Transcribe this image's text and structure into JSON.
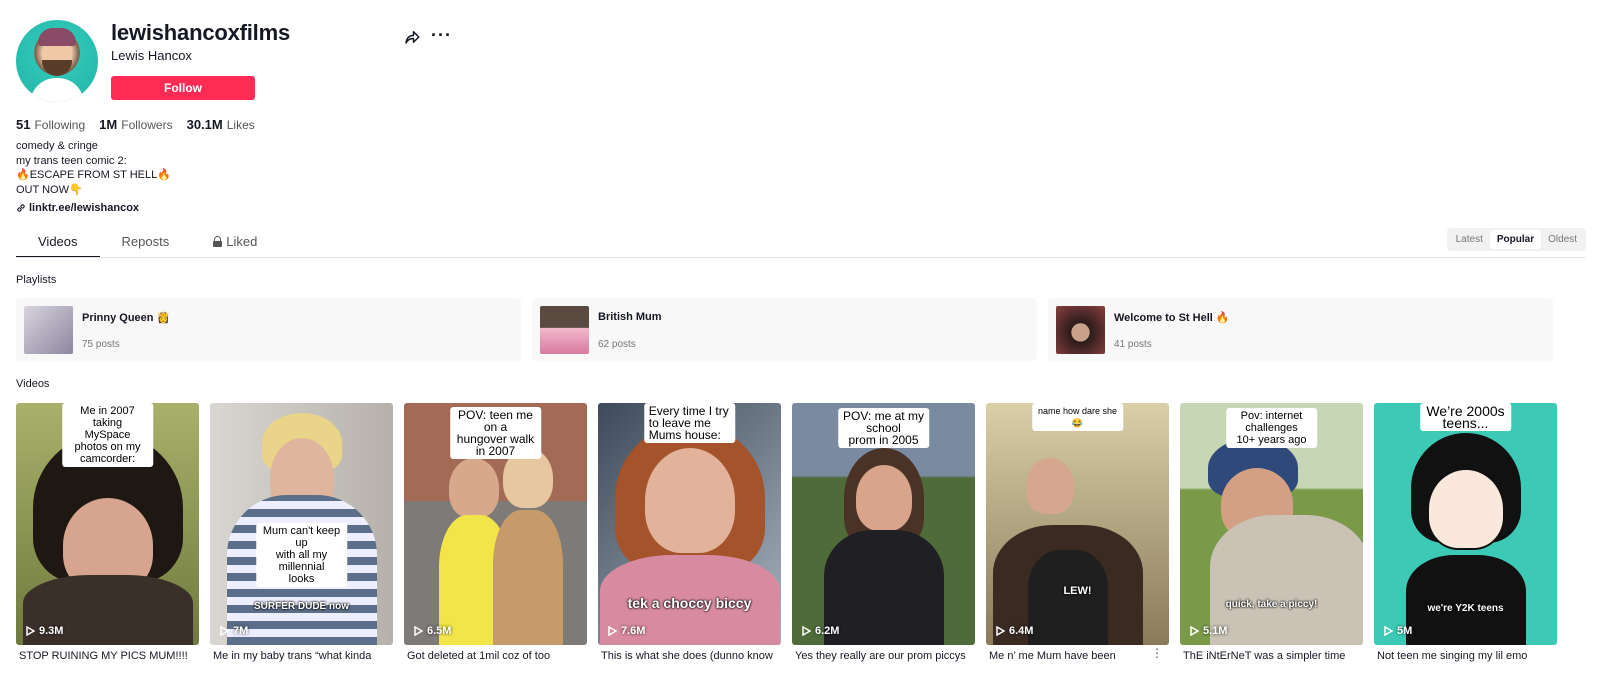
{
  "profile": {
    "username": "lewishancoxfilms",
    "display_name": "Lewis Hancox",
    "follow_label": "Follow",
    "stats": [
      {
        "value": "51",
        "label": "Following"
      },
      {
        "value": "1M",
        "label": "Followers"
      },
      {
        "value": "30.1M",
        "label": "Likes"
      }
    ],
    "bio": [
      "comedy & cringe",
      "my trans teen comic 2:",
      "🔥ESCAPE FROM ST HELL🔥",
      "OUT NOW👇"
    ],
    "link": "linktr.ee/lewishancox"
  },
  "tabs": [
    {
      "label": "Videos",
      "active": true
    },
    {
      "label": "Reposts",
      "active": false
    },
    {
      "label": "Liked",
      "active": false
    }
  ],
  "sort": [
    {
      "label": "Latest",
      "active": false
    },
    {
      "label": "Popular",
      "active": true
    },
    {
      "label": "Oldest",
      "active": false
    }
  ],
  "sections": {
    "playlists": "Playlists",
    "videos": "Videos"
  },
  "playlists": [
    {
      "name": "Prinny Queen 👸",
      "count": "75 posts",
      "color": "#b9b3c6"
    },
    {
      "name": "British Mum",
      "count": "62 posts",
      "color": "#e7a0b8"
    },
    {
      "name": "Welcome to St Hell 🔥",
      "count": "41 posts",
      "color": "#6b3b3b"
    }
  ],
  "videos": [
    {
      "title": "STOP RUINING MY PICS MUM!!!!",
      "views": "9.3M",
      "caption": "Me in 2007 taking\nMySpace photos on my\ncamcorder:",
      "overlay": "",
      "bg": "#8f9a52"
    },
    {
      "title": "Me in my baby trans “what kinda",
      "views": "7M",
      "caption": "Mum can't keep up\nwith all my millennial\nlooks",
      "overlay": "SURFER DUDE now",
      "bg": "#c9c5c0"
    },
    {
      "title": "Got deleted at 1mil coz of too",
      "views": "6.5M",
      "caption": "POV: teen me on a\nhungover walk in 2007",
      "overlay": "",
      "bg": "#8b5a4a"
    },
    {
      "title": "This is what she does (dunno know",
      "views": "7.6M",
      "caption": "Every time I try to leave me\nMums house:",
      "overlay": "tek a choccy biccy",
      "bg": "#6a7f95"
    },
    {
      "title": "Yes they really are our prom piccys",
      "views": "6.2M",
      "caption": "POV: me at my school\nprom in 2005",
      "overlay": "",
      "bg": "#5f6d52"
    },
    {
      "title": "Me n’ me Mum have been",
      "views": "6.4M",
      "caption": "name how dare she 😂",
      "overlay": "LEW!",
      "bg": "#b7a98a"
    },
    {
      "title": "ThE iNtErNeT was a simpler time",
      "views": "5.1M",
      "caption": "Pov: internet challenges\n10+ years ago",
      "overlay": "quick, take a piccy!",
      "bg": "#8fae6a"
    },
    {
      "title": "Not teen me singing my lil emo",
      "views": "5M",
      "caption": "We’re 2000s teens...",
      "overlay": "we're Y2K teens",
      "bg": "#3ccab7"
    }
  ]
}
